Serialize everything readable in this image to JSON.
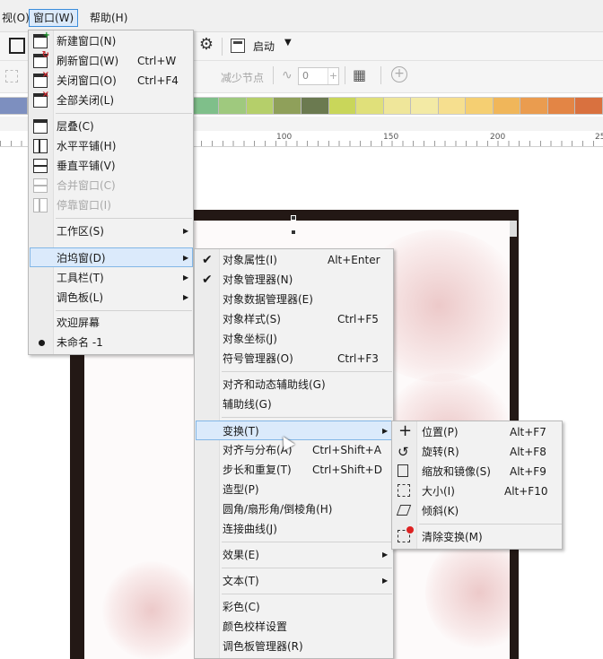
{
  "menubar": {
    "items": [
      "视(O)",
      "窗口(W)",
      "帮助(H)"
    ]
  },
  "toolbar": {
    "launch_label": "启动",
    "reduce_nodes_label": "减少节点",
    "spin_value": "0"
  },
  "ruler": {
    "labels": [
      "100",
      "150",
      "200",
      "25"
    ]
  },
  "palette": {
    "colors": [
      "#7d8fbf",
      "#5a6fb0",
      "#4a8fc7",
      "#3ea6c9",
      "#5ab3b5",
      "#4db399",
      "#5fb58c",
      "#7fbf8a",
      "#9fc97e",
      "#b5cf6a",
      "#8fa05a",
      "#6b7a50",
      "#c9d65a",
      "#e0e07a",
      "#efe69a",
      "#f3eaa5",
      "#f6df8f",
      "#f5cf72",
      "#f0b65a",
      "#ea9c4f",
      "#e38545",
      "#d9713f"
    ]
  },
  "window_menu": {
    "items": [
      {
        "label": "新建窗口(N)",
        "shortcut": "",
        "icon": "new-window-icon"
      },
      {
        "label": "刷新窗口(W)",
        "shortcut": "Ctrl+W",
        "icon": "refresh-window-icon"
      },
      {
        "label": "关闭窗口(O)",
        "shortcut": "Ctrl+F4",
        "icon": "close-window-icon"
      },
      {
        "label": "全部关闭(L)",
        "shortcut": "",
        "icon": "close-all-icon"
      },
      {
        "label": "层叠(C)",
        "shortcut": "",
        "icon": "cascade-icon"
      },
      {
        "label": "水平平铺(H)",
        "shortcut": "",
        "icon": "tile-horizontal-icon"
      },
      {
        "label": "垂直平铺(V)",
        "shortcut": "",
        "icon": "tile-vertical-icon"
      },
      {
        "label": "合并窗口(C)",
        "shortcut": "",
        "icon": "merge-window-icon"
      },
      {
        "label": "停靠窗口(I)",
        "shortcut": "",
        "icon": "dock-window-icon"
      },
      {
        "label": "工作区(S)",
        "shortcut": "",
        "icon": ""
      },
      {
        "label": "泊坞窗(D)",
        "shortcut": "",
        "icon": ""
      },
      {
        "label": "工具栏(T)",
        "shortcut": "",
        "icon": ""
      },
      {
        "label": "调色板(L)",
        "shortcut": "",
        "icon": ""
      },
      {
        "label": "欢迎屏幕",
        "shortcut": "",
        "icon": ""
      },
      {
        "label": "未命名 -1",
        "shortcut": "",
        "icon": ""
      }
    ]
  },
  "docker_menu": {
    "items": [
      {
        "label": "对象属性(I)",
        "shortcut": "Alt+Enter"
      },
      {
        "label": "对象管理器(N)",
        "shortcut": ""
      },
      {
        "label": "对象数据管理器(E)",
        "shortcut": ""
      },
      {
        "label": "对象样式(S)",
        "shortcut": "Ctrl+F5"
      },
      {
        "label": "对象坐标(J)",
        "shortcut": ""
      },
      {
        "label": "符号管理器(O)",
        "shortcut": "Ctrl+F3"
      },
      {
        "label": "对齐和动态辅助线(G)",
        "shortcut": ""
      },
      {
        "label": "辅助线(G)",
        "shortcut": ""
      },
      {
        "label": "变换(T)",
        "shortcut": ""
      },
      {
        "label": "对齐与分布(A)",
        "shortcut": "Ctrl+Shift+A"
      },
      {
        "label": "步长和重复(T)",
        "shortcut": "Ctrl+Shift+D"
      },
      {
        "label": "造型(P)",
        "shortcut": ""
      },
      {
        "label": "圆角/扇形角/倒棱角(H)",
        "shortcut": ""
      },
      {
        "label": "连接曲线(J)",
        "shortcut": ""
      },
      {
        "label": "效果(E)",
        "shortcut": ""
      },
      {
        "label": "文本(T)",
        "shortcut": ""
      },
      {
        "label": "彩色(C)",
        "shortcut": ""
      },
      {
        "label": "颜色校样设置",
        "shortcut": ""
      },
      {
        "label": "调色板管理器(R)",
        "shortcut": ""
      }
    ]
  },
  "transform_menu": {
    "items": [
      {
        "label": "位置(P)",
        "shortcut": "Alt+F7",
        "icon": "position-icon"
      },
      {
        "label": "旋转(R)",
        "shortcut": "Alt+F8",
        "icon": "rotate-icon"
      },
      {
        "label": "缩放和镜像(S)",
        "shortcut": "Alt+F9",
        "icon": "scale-mirror-icon"
      },
      {
        "label": "大小(I)",
        "shortcut": "Alt+F10",
        "icon": "size-icon"
      },
      {
        "label": "倾斜(K)",
        "shortcut": "",
        "icon": "skew-icon"
      },
      {
        "label": "清除变换(M)",
        "shortcut": "",
        "icon": "clear-transform-icon"
      }
    ]
  }
}
